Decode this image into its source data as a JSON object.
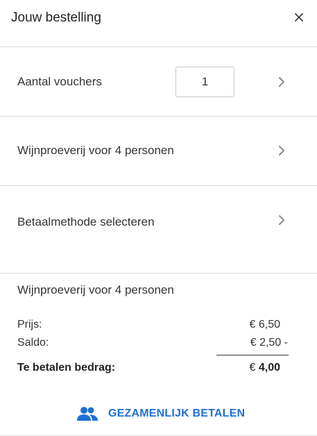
{
  "header": {
    "title": "Jouw bestelling",
    "close_icon": "close-icon"
  },
  "rows": {
    "vouchers": {
      "label": "Aantal vouchers",
      "quantity": "1"
    },
    "product": {
      "label": "Wijnproeverij voor 4 personen"
    },
    "payment": {
      "label": "Betaalmethode selecteren"
    }
  },
  "summary": {
    "product": "Wijnproeverij voor 4 personen",
    "price_label": "Prijs:",
    "price_value": "€ 6,50",
    "balance_label": "Saldo:",
    "balance_value": "€ 2,50 -",
    "total_label": "Te betalen bedrag:",
    "total_currency": "€",
    "total_amount": "4,00"
  },
  "footer": {
    "group_pay_label": "GEZAMENLIJK BETALEN",
    "group_pay_icon": "people-icon"
  },
  "colors": {
    "accent": "#1f6fd8",
    "divider": "#dcdcdc",
    "chevron": "#8a8a8a"
  }
}
